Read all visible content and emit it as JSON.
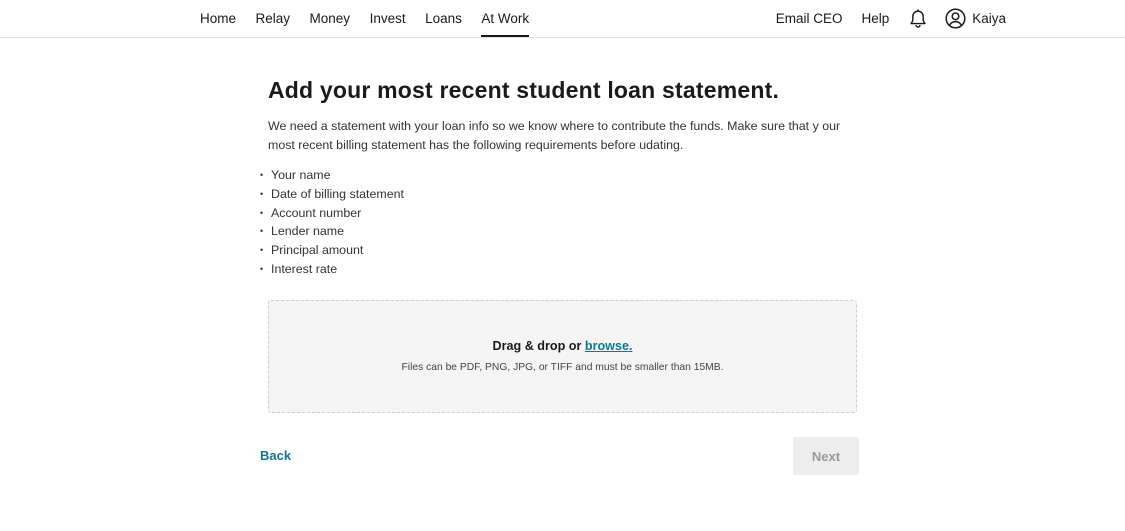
{
  "nav": {
    "left_items": [
      {
        "label": "Home",
        "active": false
      },
      {
        "label": "Relay",
        "active": false
      },
      {
        "label": "Money",
        "active": false
      },
      {
        "label": "Invest",
        "active": false
      },
      {
        "label": "Loans",
        "active": false
      },
      {
        "label": "At Work",
        "active": true
      }
    ],
    "email_ceo": "Email CEO",
    "help": "Help",
    "notifications_icon": "bell-icon",
    "user_icon": "user-circle-icon",
    "user_name": "Kaiya"
  },
  "main": {
    "title": "Add your most recent student loan statement.",
    "intro": "We need a statement with your loan info so we know where to contribute the funds. Make sure that y our most recent billing statement has the following requirements before udating.",
    "requirements": [
      "Your name",
      "Date of billing statement",
      "Account number",
      "Lender name",
      "Principal amount",
      "Interest rate"
    ],
    "dropzone": {
      "prefix": "Drag & drop or ",
      "browse_link": "browse.",
      "note": "Files can be PDF, PNG, JPG, or TIFF and must be smaller than 15MB."
    }
  },
  "footer": {
    "back_label": "Back",
    "next_label": "Next",
    "next_disabled": true
  },
  "colors": {
    "link": "#0b7a99",
    "text": "#1a1a1a",
    "dropzone_bg": "#f5f5f5",
    "disabled_button_bg": "#ededed",
    "disabled_button_text": "#9a9a9a"
  }
}
